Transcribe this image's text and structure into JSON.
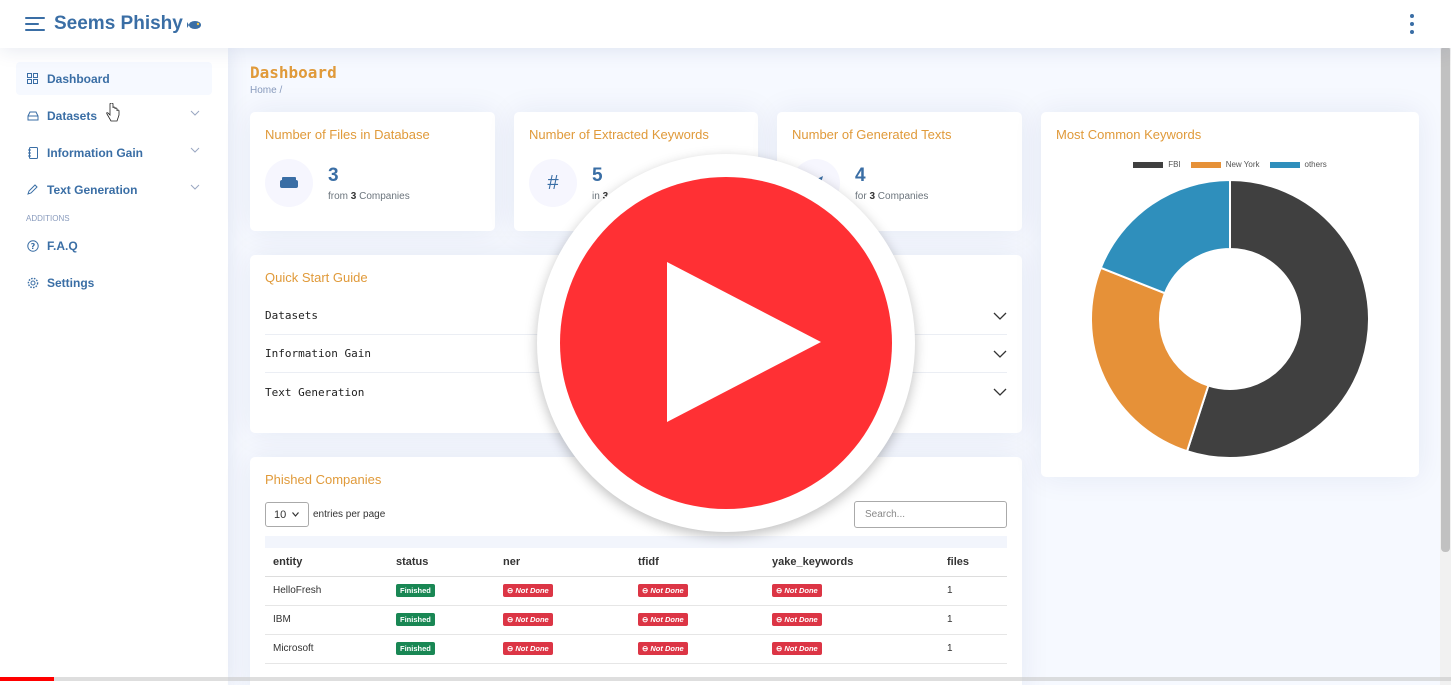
{
  "app": {
    "title": "Seems Phishy"
  },
  "sidebar": {
    "items": [
      {
        "label": "Dashboard",
        "icon": "grid-icon"
      },
      {
        "label": "Datasets",
        "icon": "disk-icon"
      },
      {
        "label": "Information Gain",
        "icon": "journal-icon"
      },
      {
        "label": "Text Generation",
        "icon": "pen-icon"
      }
    ],
    "heading": "ADDITIONS",
    "extra": [
      {
        "label": "F.A.Q",
        "icon": "question-icon"
      },
      {
        "label": "Settings",
        "icon": "gear-icon"
      }
    ]
  },
  "page": {
    "title": "Dashboard",
    "breadcrumb": "Home  /"
  },
  "stats": [
    {
      "title": "Number of Files in Database",
      "value": "3",
      "prefix": "from",
      "count": "3",
      "suffix": "Companies",
      "icon": "hdd-icon"
    },
    {
      "title": "Number of Extracted Keywords",
      "value": "5",
      "prefix": "in",
      "count": "3",
      "suffix": "",
      "icon": "hash-icon"
    },
    {
      "title": "Number of Generated Texts",
      "value": "4",
      "prefix": "for",
      "count": "3",
      "suffix": "Companies",
      "icon": "send-icon"
    }
  ],
  "guide": {
    "title": "Quick Start Guide",
    "rows": [
      "Datasets",
      "Information Gain",
      "Text Generation"
    ]
  },
  "companies": {
    "title": "Phished Companies",
    "page_size": "10",
    "entries_label": "entries per page",
    "search_placeholder": "Search...",
    "columns": [
      "entity",
      "status",
      "ner",
      "tfidf",
      "yake_keywords",
      "files"
    ],
    "rows": [
      {
        "entity": "HelloFresh",
        "status": "Finished",
        "ner": "Not Done",
        "tfidf": "Not Done",
        "yake": "Not Done",
        "files": "1"
      },
      {
        "entity": "IBM",
        "status": "Finished",
        "ner": "Not Done",
        "tfidf": "Not Done",
        "yake": "Not Done",
        "files": "1"
      },
      {
        "entity": "Microsoft",
        "status": "Finished",
        "ner": "Not Done",
        "tfidf": "Not Done",
        "yake": "Not Done",
        "files": "1"
      }
    ]
  },
  "chart_data": {
    "type": "pie",
    "title": "Most Common Keywords",
    "categories": [
      "FBI",
      "New York",
      "others"
    ],
    "values": [
      55,
      26,
      19
    ],
    "colors": [
      "#404040",
      "#e69138",
      "#2f8fbc"
    ],
    "legend_position": "top"
  },
  "video": {
    "progress": 0.037
  }
}
